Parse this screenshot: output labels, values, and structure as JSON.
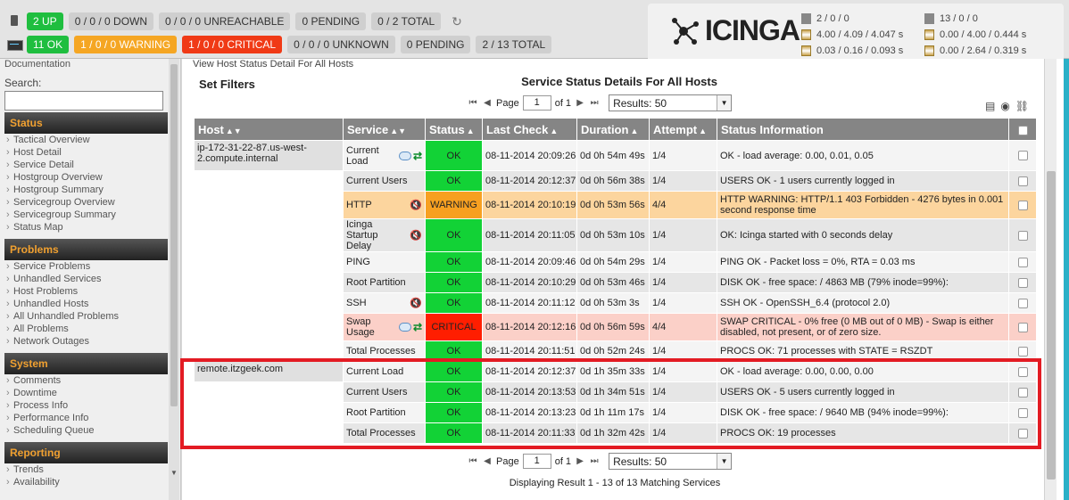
{
  "topbar": {
    "hosts": {
      "up": "2 UP",
      "down": "0 / 0 / 0 DOWN",
      "unreachable": "0 / 0 / 0 UNREACHABLE",
      "pending": "0 PENDING",
      "total": "0 / 2 TOTAL"
    },
    "services": {
      "ok": "11 OK",
      "warning": "1 / 0 / 0 WARNING",
      "critical": "1 / 0 / 0 CRITICAL",
      "unknown": "0 / 0 / 0 UNKNOWN",
      "pending": "0 PENDING",
      "total": "2 / 13 TOTAL"
    },
    "refresh_icon": "refresh-icon"
  },
  "logo": {
    "text": "ICINGA"
  },
  "stats": {
    "host_count": "2 / 0 / 0",
    "host_latency": "4.00 / 4.09 / 4.047 s",
    "host_exec": "0.03 / 0.16 / 0.093 s",
    "svc_count": "13 / 0 / 0",
    "svc_latency": "0.00 / 4.00 / 0.444 s",
    "svc_exec": "0.00 / 2.64 / 0.319 s"
  },
  "sidebar": {
    "doc_partial": "Documentation",
    "search_label": "Search:",
    "sections": [
      {
        "title": "Status",
        "items": [
          "Tactical Overview",
          "Host Detail",
          "Service Detail",
          "Hostgroup Overview",
          "Hostgroup Summary",
          "Servicegroup Overview",
          "Servicegroup Summary",
          "Status Map"
        ]
      },
      {
        "title": "Problems",
        "items": [
          "Service Problems",
          "Unhandled Services",
          "Host Problems",
          "Unhandled Hosts",
          "All Unhandled Problems",
          "All Problems",
          "Network Outages"
        ]
      },
      {
        "title": "System",
        "items": [
          "Comments",
          "Downtime",
          "Process Info",
          "Performance Info",
          "Scheduling Queue"
        ]
      },
      {
        "title": "Reporting",
        "items": [
          "Trends",
          "Availability"
        ]
      }
    ]
  },
  "main": {
    "crumb_partial": "View Host Status Detail For All Hosts",
    "set_filters": "Set Filters",
    "title": "Service Status Details For All Hosts",
    "pager": {
      "page_label": "Page",
      "page_value": "1",
      "of_label": "of 1",
      "results": "Results: 50"
    },
    "columns": [
      "Host",
      "Service",
      "Status",
      "Last Check",
      "Duration",
      "Attempt",
      "Status Information"
    ],
    "hosts": [
      {
        "name": "ip-172-31-22-87.us-west-2.compute.internal",
        "services": [
          {
            "service": "Current Load",
            "status": "OK",
            "last_check": "08-11-2014 20:09:26",
            "duration": "0d 0h 54m 49s",
            "attempt": "1/4",
            "info": "OK - load average: 0.00, 0.01, 0.05",
            "icons": [
              "comment",
              "passive"
            ]
          },
          {
            "service": "Current Users",
            "status": "OK",
            "last_check": "08-11-2014 20:12:37",
            "duration": "0d 0h 56m 38s",
            "attempt": "1/4",
            "info": "USERS OK - 1 users currently logged in",
            "icons": []
          },
          {
            "service": "HTTP",
            "status": "WARNING",
            "last_check": "08-11-2014 20:10:19",
            "duration": "0d 0h 53m 56s",
            "attempt": "4/4",
            "info": "HTTP WARNING: HTTP/1.1 403 Forbidden - 4276 bytes in 0.001 second response time",
            "icons": [
              "mute"
            ]
          },
          {
            "service": "Icinga Startup Delay",
            "status": "OK",
            "last_check": "08-11-2014 20:11:05",
            "duration": "0d 0h 53m 10s",
            "attempt": "1/4",
            "info": "OK: Icinga started with 0 seconds delay",
            "icons": [
              "mute"
            ]
          },
          {
            "service": "PING",
            "status": "OK",
            "last_check": "08-11-2014 20:09:46",
            "duration": "0d 0h 54m 29s",
            "attempt": "1/4",
            "info": "PING OK - Packet loss = 0%, RTA = 0.03 ms",
            "icons": []
          },
          {
            "service": "Root Partition",
            "status": "OK",
            "last_check": "08-11-2014 20:10:29",
            "duration": "0d 0h 53m 46s",
            "attempt": "1/4",
            "info": "DISK OK - free space: / 4863 MB (79% inode=99%):",
            "icons": []
          },
          {
            "service": "SSH",
            "status": "OK",
            "last_check": "08-11-2014 20:11:12",
            "duration": "0d 0h 53m 3s",
            "attempt": "1/4",
            "info": "SSH OK - OpenSSH_6.4 (protocol 2.0)",
            "icons": [
              "mute"
            ]
          },
          {
            "service": "Swap Usage",
            "status": "CRITICAL",
            "last_check": "08-11-2014 20:12:16",
            "duration": "0d 0h 56m 59s",
            "attempt": "4/4",
            "info": "SWAP CRITICAL - 0% free (0 MB out of 0 MB) - Swap is either disabled, not present, or of zero size.",
            "icons": [
              "comment",
              "passive"
            ]
          },
          {
            "service": "Total Processes",
            "status": "OK",
            "last_check": "08-11-2014 20:11:51",
            "duration": "0d 0h 52m 24s",
            "attempt": "1/4",
            "info": "PROCS OK: 71 processes with STATE = RSZDT",
            "icons": []
          }
        ]
      },
      {
        "name": "remote.itzgeek.com",
        "services": [
          {
            "service": "Current Load",
            "status": "OK",
            "last_check": "08-11-2014 20:12:37",
            "duration": "0d 1h 35m 33s",
            "attempt": "1/4",
            "info": "OK - load average: 0.00, 0.00, 0.00",
            "icons": []
          },
          {
            "service": "Current Users",
            "status": "OK",
            "last_check": "08-11-2014 20:13:53",
            "duration": "0d 1h 34m 51s",
            "attempt": "1/4",
            "info": "USERS OK - 5 users currently logged in",
            "icons": []
          },
          {
            "service": "Root Partition",
            "status": "OK",
            "last_check": "08-11-2014 20:13:23",
            "duration": "0d 1h 11m 17s",
            "attempt": "1/4",
            "info": "DISK OK - free space: / 9640 MB (94% inode=99%):",
            "icons": []
          },
          {
            "service": "Total Processes",
            "status": "OK",
            "last_check": "08-11-2014 20:11:33",
            "duration": "0d 1h 32m 42s",
            "attempt": "1/4",
            "info": "PROCS OK: 19 processes",
            "icons": []
          }
        ]
      }
    ],
    "footer": "Displaying Result 1 - 13 of 13 Matching Services"
  }
}
